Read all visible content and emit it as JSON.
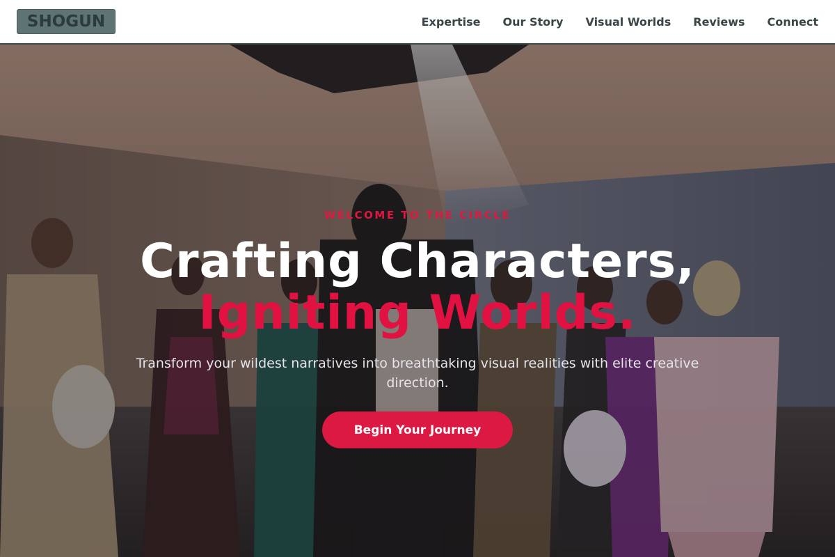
{
  "header": {
    "logo": "SHOGUN",
    "nav": [
      {
        "label": "Expertise"
      },
      {
        "label": "Our Story"
      },
      {
        "label": "Visual Worlds"
      },
      {
        "label": "Reviews"
      },
      {
        "label": "Connect"
      }
    ]
  },
  "hero": {
    "eyebrow": "WELCOME TO THE CIRCLE",
    "headline_line1": "Crafting Characters,",
    "headline_line2": "Igniting Worlds.",
    "subtitle": "Transform your wildest narratives into breathtaking visual realities with elite creative direction.",
    "cta_label": "Begin Your Journey",
    "background_image": "group-of-costumed-performers-photo"
  },
  "colors": {
    "accent": "#e11241",
    "header_bg": "#ffffff",
    "logo_bg": "#5e7373",
    "nav_text": "#3a4547"
  }
}
